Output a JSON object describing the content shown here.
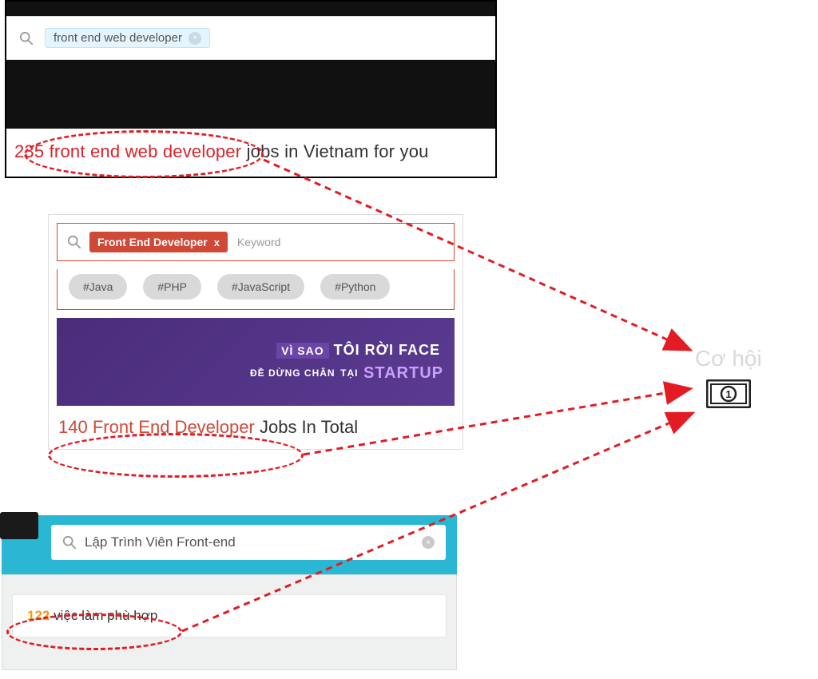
{
  "panel1": {
    "search_query": "front end web developer",
    "result_count": "235",
    "result_highlight": "front end web developer",
    "result_suffix": " jobs in Vietnam for you"
  },
  "panel2": {
    "pill_label": "Front End Developer",
    "placeholder": "Keyword",
    "tags": [
      "#Java",
      "#PHP",
      "#JavaScript",
      "#Python"
    ],
    "banner_line1_pre": "VÌ SAO",
    "banner_line1": "TÔI RỜI FACE",
    "banner_line2_pre": "ĐỀ DỪNG CHÂN",
    "banner_line2_small": "TẠI",
    "banner_line2_startup": "STARTUP",
    "result_count": "140",
    "result_highlight": "Front End Developer",
    "result_suffix": " Jobs In Total"
  },
  "panel3": {
    "search_query": "Lập Trình Viên Front-end",
    "result_count": "122",
    "result_suffix": " việc làm phù hợp"
  },
  "right": {
    "label": "Cơ hội"
  }
}
